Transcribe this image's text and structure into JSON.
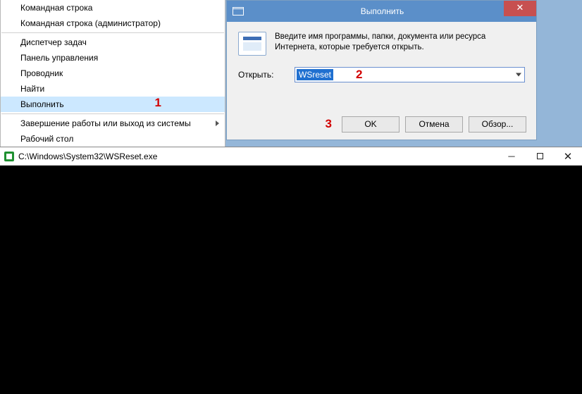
{
  "start_menu": {
    "items": [
      {
        "label": "Командная строка"
      },
      {
        "label": "Командная строка (администратор)"
      }
    ],
    "items2": [
      {
        "label": "Диспетчер задач"
      },
      {
        "label": "Панель управления"
      },
      {
        "label": "Проводник"
      },
      {
        "label": "Найти"
      },
      {
        "label": "Выполнить",
        "selected": true
      }
    ],
    "items3": [
      {
        "label": "Завершение работы или выход из системы",
        "submenu": true
      },
      {
        "label": "Рабочий стол"
      }
    ]
  },
  "annotations": {
    "a1": "1",
    "a2": "2",
    "a3": "3"
  },
  "run_dialog": {
    "title": "Выполнить",
    "description": "Введите имя программы, папки, документа или ресурса Интернета, которые требуется открыть.",
    "open_label": "Открыть:",
    "input_value": "WSreset",
    "ok_label": "OK",
    "cancel_label": "Отмена",
    "browse_label": "Обзор..."
  },
  "console": {
    "title": "C:\\Windows\\System32\\WSReset.exe"
  }
}
